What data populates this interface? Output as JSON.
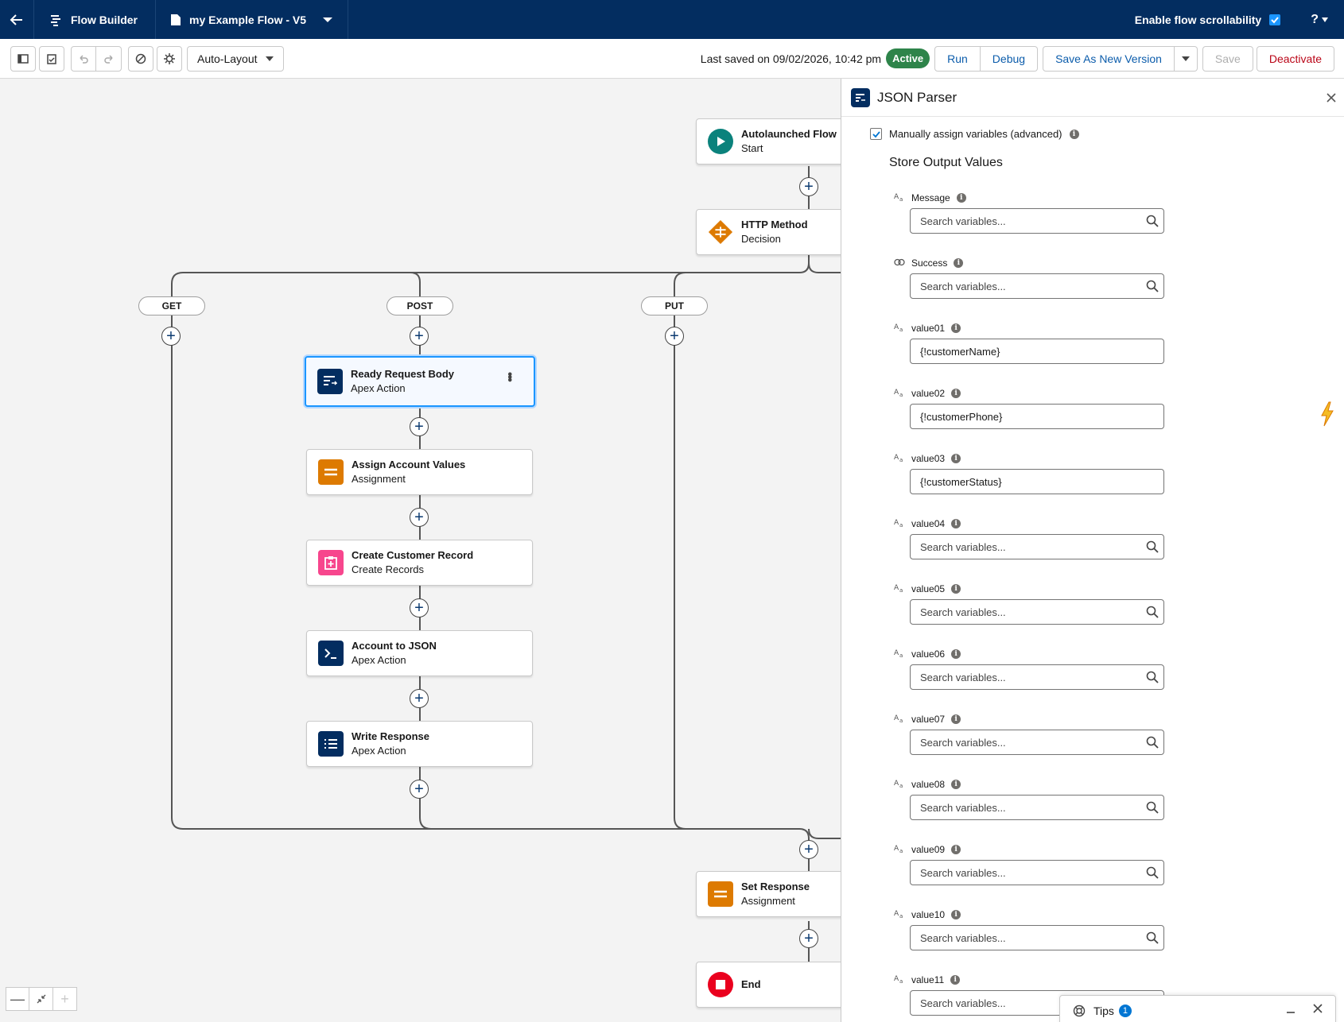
{
  "topbar": {
    "app_title": "Flow Builder",
    "flow_name": "my Example Flow - V5",
    "scroll_label": "Enable flow scrollability",
    "help_label": "?"
  },
  "toolbar": {
    "layout_mode": "Auto-Layout",
    "last_saved": "Last saved on 09/02/2026, 10:42 pm",
    "status": "Active",
    "run_label": "Run",
    "debug_label": "Debug",
    "save_new_version_label": "Save As New Version",
    "save_label": "Save",
    "deactivate_label": "Deactivate"
  },
  "canvas": {
    "branches": [
      "GET",
      "POST",
      "PUT"
    ],
    "nodes": {
      "start": {
        "title": "Autolaunched Flow",
        "subtitle": "Start"
      },
      "decision": {
        "title": "HTTP Method",
        "subtitle": "Decision"
      },
      "ready": {
        "title": "Ready Request Body",
        "subtitle": "Apex Action"
      },
      "assign": {
        "title": "Assign Account Values",
        "subtitle": "Assignment"
      },
      "create": {
        "title": "Create Customer Record",
        "subtitle": "Create Records"
      },
      "tojson": {
        "title": "Account to JSON",
        "subtitle": "Apex Action"
      },
      "write": {
        "title": "Write Response",
        "subtitle": "Apex Action"
      },
      "setresp": {
        "title": "Set Response",
        "subtitle": "Assignment"
      },
      "end": {
        "title": "End"
      }
    },
    "zoom": {
      "out": "—",
      "fit": "↙↗",
      "in": "+"
    }
  },
  "panel": {
    "title": "JSON Parser",
    "manual_label": "Manually assign variables (advanced)",
    "section_title": "Store Output Values",
    "placeholder": "Search variables...",
    "fields": [
      {
        "type": "Aa",
        "label": "Message",
        "value": ""
      },
      {
        "type": "bool",
        "label": "Success",
        "value": ""
      },
      {
        "type": "Aa",
        "label": "value01",
        "value": "{!customerName}"
      },
      {
        "type": "Aa",
        "label": "value02",
        "value": "{!customerPhone}"
      },
      {
        "type": "Aa",
        "label": "value03",
        "value": "{!customerStatus}"
      },
      {
        "type": "Aa",
        "label": "value04",
        "value": ""
      },
      {
        "type": "Aa",
        "label": "value05",
        "value": ""
      },
      {
        "type": "Aa",
        "label": "value06",
        "value": ""
      },
      {
        "type": "Aa",
        "label": "value07",
        "value": ""
      },
      {
        "type": "Aa",
        "label": "value08",
        "value": ""
      },
      {
        "type": "Aa",
        "label": "value09",
        "value": ""
      },
      {
        "type": "Aa",
        "label": "value10",
        "value": ""
      },
      {
        "type": "Aa",
        "label": "value11",
        "value": ""
      }
    ]
  },
  "tips": {
    "label": "Tips",
    "count": "1"
  },
  "colors": {
    "navy": "#032d60",
    "accent_blue": "#0176d3",
    "active_green": "#2e844a",
    "start_teal": "#0b827c",
    "decision_orange": "#dd7a01",
    "create_pink": "#f7468d",
    "end_red": "#ea001e"
  }
}
